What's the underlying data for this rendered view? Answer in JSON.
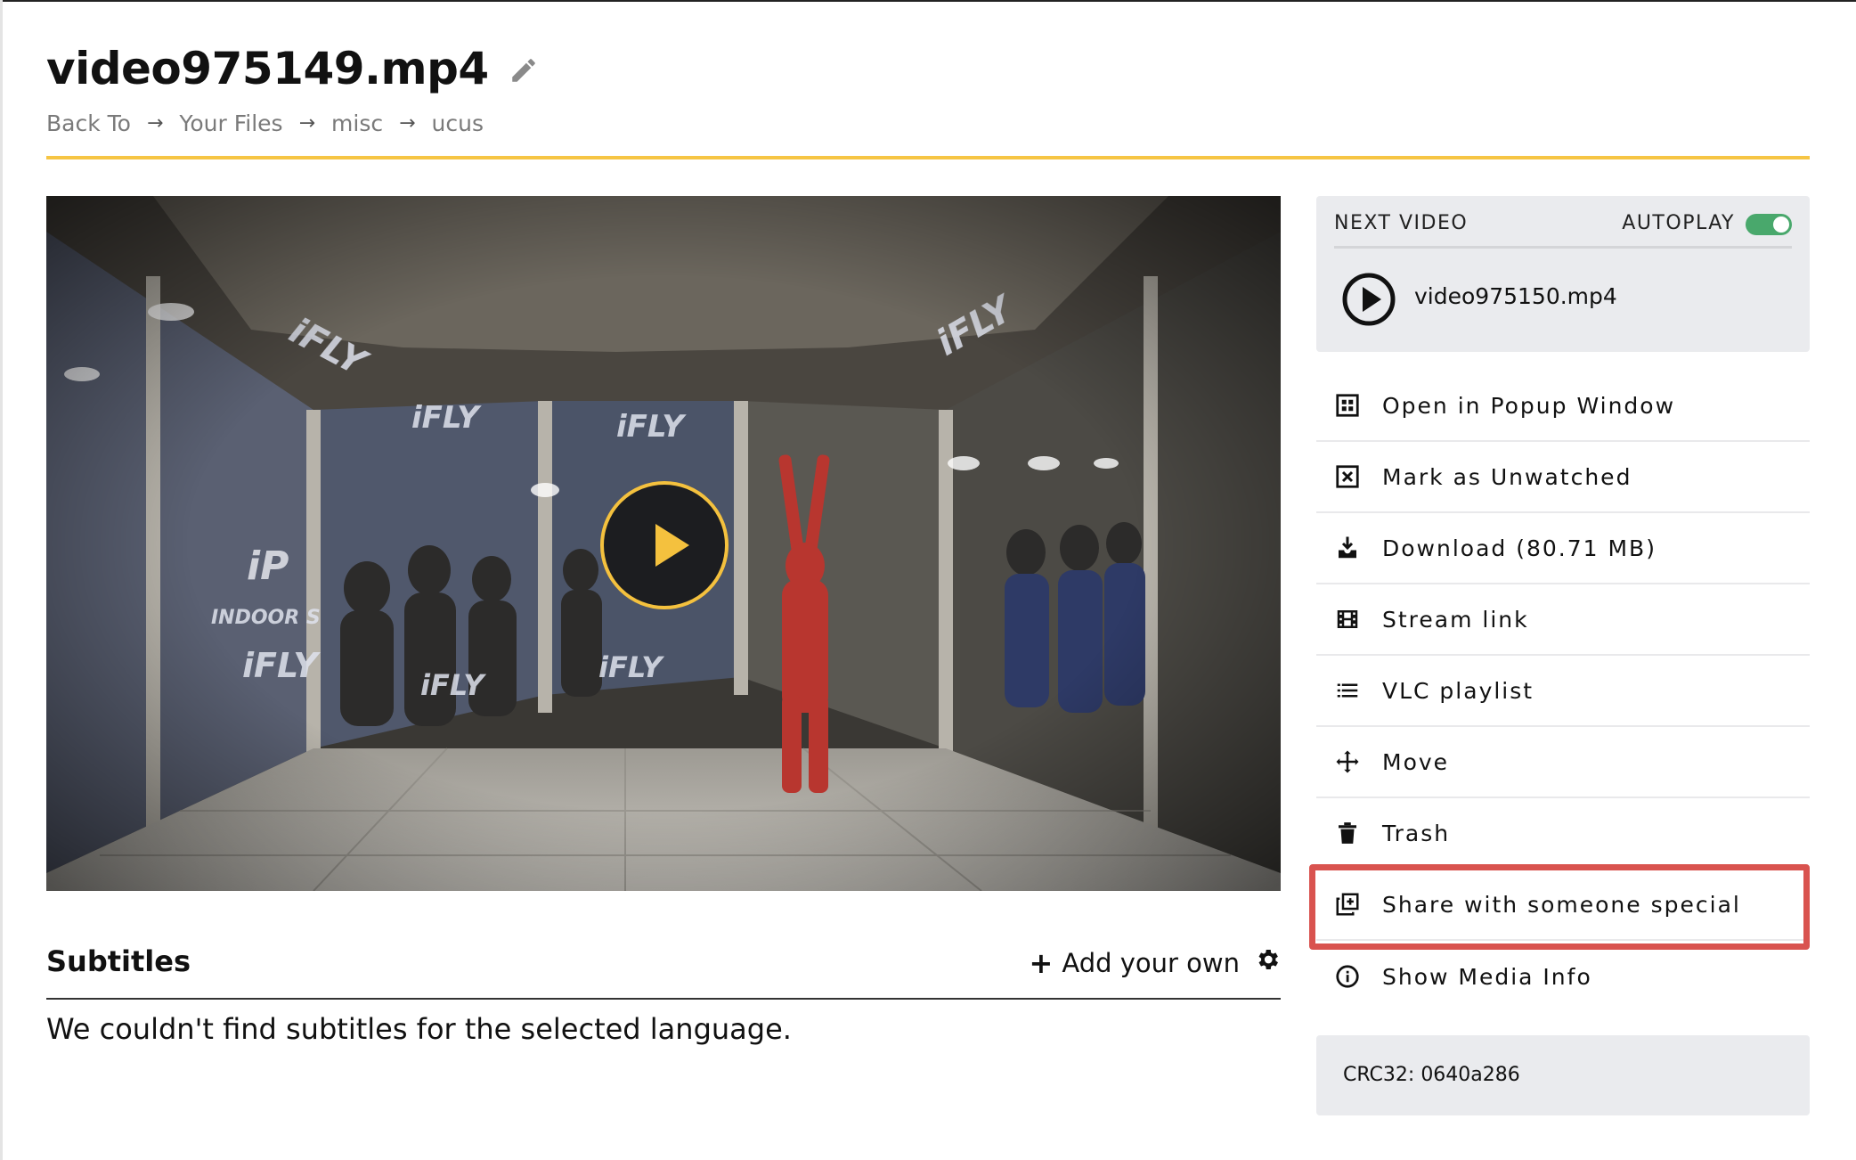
{
  "file": {
    "title": "video975149.mp4"
  },
  "breadcrumb": [
    "Back To",
    "Your Files",
    "misc",
    "ucus"
  ],
  "video": {
    "wall_signs": [
      "iFLY",
      "iFLY",
      "iFLY",
      "iFLY",
      "iFLY",
      "iFLY",
      "iFLY"
    ],
    "wall_signs_lower": [
      "INDOOR S",
      "iP"
    ],
    "accent_color": "#f4c13e"
  },
  "subtitles": {
    "title": "Subtitles",
    "add_own": "Add your own",
    "message": "We couldn't find subtitles for the selected language."
  },
  "next_video": {
    "label": "NEXT VIDEO",
    "autoplay_label": "AUTOPLAY",
    "autoplay_on": true,
    "name": "video975150.mp4"
  },
  "menu": [
    {
      "icon": "popup-window-icon",
      "label": "Open in Popup Window"
    },
    {
      "icon": "mark-unwatched-icon",
      "label": "Mark as Unwatched"
    },
    {
      "icon": "download-icon",
      "label": "Download (80.71 MB)"
    },
    {
      "icon": "film-icon",
      "label": "Stream link"
    },
    {
      "icon": "list-icon",
      "label": "VLC playlist"
    },
    {
      "icon": "move-icon",
      "label": "Move"
    },
    {
      "icon": "trash-icon",
      "label": "Trash"
    },
    {
      "icon": "share-icon",
      "label": "Share with someone special"
    },
    {
      "icon": "info-icon",
      "label": "Show Media Info"
    }
  ],
  "crc": "CRC32: 0640a286",
  "colors": {
    "accent_yellow": "#f6c544",
    "toggle_green": "#49a86c",
    "highlight_red": "#d9534f",
    "panel_gray": "#eaebee"
  }
}
